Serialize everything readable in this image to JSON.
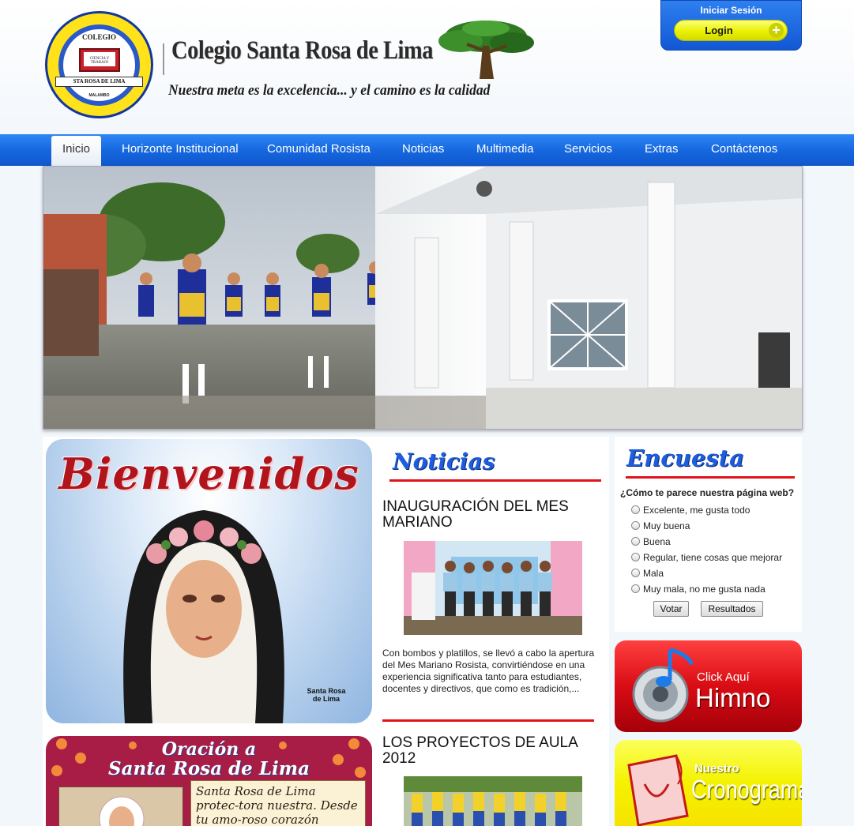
{
  "header": {
    "title": "Colegio Santa Rosa de Lima",
    "slogan": "Nuestra meta es la excelencia... y el camino es la calidad",
    "logo": {
      "top_text": "COLEGIO",
      "book_text": "CIENCIA Y TRABAJO",
      "ribbon_text": "STA ROSA DE LIMA",
      "bottom_text": "MALAMBO"
    }
  },
  "login": {
    "title": "Iniciar Sesión",
    "button_label": "Login"
  },
  "nav": {
    "items": [
      {
        "label": "Inicio"
      },
      {
        "label": "Horizonte Institucional"
      },
      {
        "label": "Comunidad Rosista"
      },
      {
        "label": "Noticias"
      },
      {
        "label": "Multimedia"
      },
      {
        "label": "Servicios"
      },
      {
        "label": "Extras"
      },
      {
        "label": "Contáctenos"
      }
    ]
  },
  "welcome": {
    "title": "Bienvenidos",
    "caption": "Santa Rosa de Lima"
  },
  "prayer": {
    "title_line1": "Oración a",
    "title_line2": "Santa Rosa de Lima",
    "text": "Santa Rosa de Lima protec-tora nuestra. Desde tu amo-roso corazón infunde amor"
  },
  "news": {
    "heading": "Noticias",
    "articles": [
      {
        "title": "INAUGURACIÓN DEL MES MARIANO",
        "summary": "Con bombos y platillos, se llevó a cabo la apertura del Mes Mariano Rosista, convirtiéndose en una experiencia significativa tanto para estudiantes, docentes y directivos, que como es tradición,..."
      },
      {
        "title": "LOS PROYECTOS DE AULA 2012"
      }
    ]
  },
  "poll": {
    "heading": "Encuesta",
    "question": "¿Cómo te parece nuestra página web?",
    "options": [
      "Excelente, me gusta todo",
      "Muy buena",
      "Buena",
      "Regular, tiene cosas que mejorar",
      "Mala",
      "Muy mala, no me gusta nada"
    ],
    "vote_label": "Votar",
    "results_label": "Resultados"
  },
  "himno": {
    "click_text": "Click Aquí",
    "title": "Himno"
  },
  "cronograma": {
    "small_text": "Nuestro",
    "title": "Cronograma"
  },
  "colors": {
    "nav_blue": "#1668e0",
    "accent_red": "#e2121b",
    "heading_blue": "#1d5ee0",
    "login_yellow": "#eaf200"
  }
}
